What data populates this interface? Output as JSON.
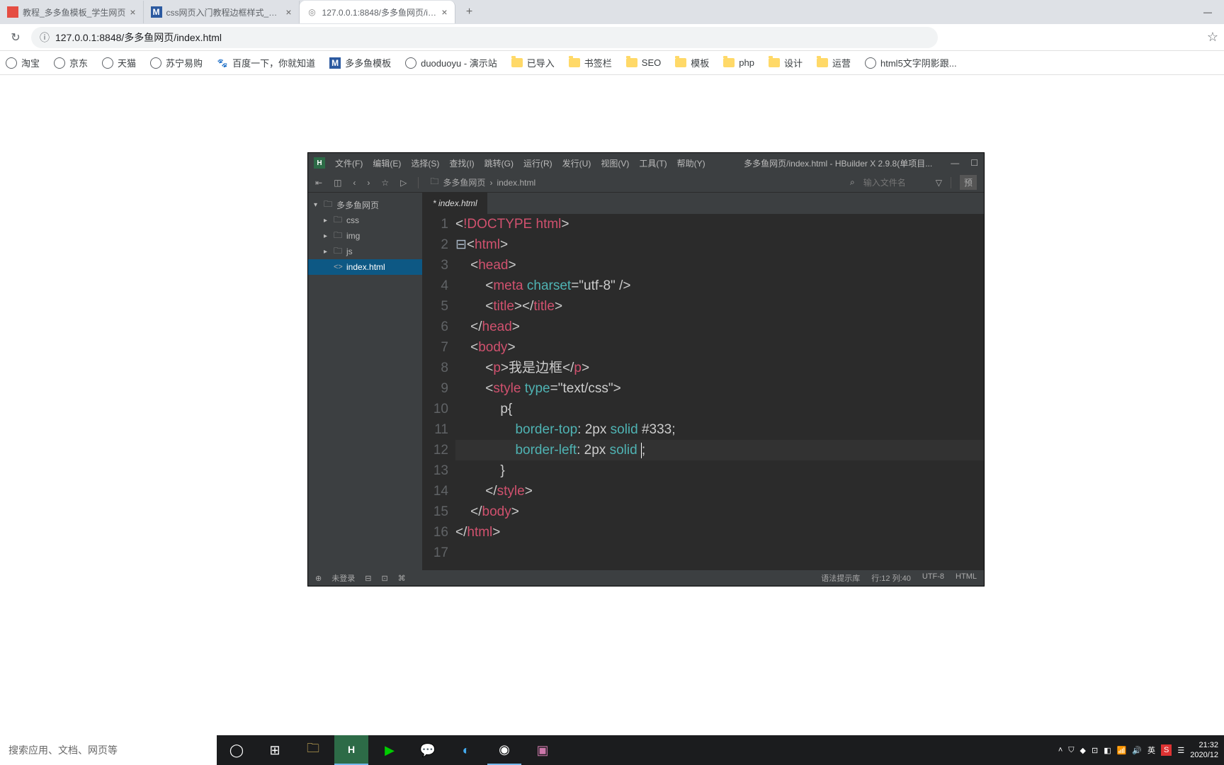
{
  "browser": {
    "tabs": [
      {
        "title": "教程_多多鱼模板_学生网页",
        "favicon_bg": "#e54d42",
        "favicon_text": ""
      },
      {
        "title": "css网页入门教程边框样式_多多...",
        "favicon_bg": "#2c5aa0",
        "favicon_text": "M"
      },
      {
        "title": "127.0.0.1:8848/多多鱼网页/ind...",
        "favicon_bg": "#999",
        "favicon_text": "◎"
      }
    ],
    "url": "127.0.0.1:8848/多多鱼网页/index.html",
    "bookmarks": [
      {
        "label": "淘宝",
        "type": "globe"
      },
      {
        "label": "京东",
        "type": "globe"
      },
      {
        "label": "天猫",
        "type": "globe"
      },
      {
        "label": "苏宁易购",
        "type": "globe"
      },
      {
        "label": "百度一下，你就知道",
        "type": "paw"
      },
      {
        "label": "多多鱼模板",
        "type": "m"
      },
      {
        "label": "duoduoyu - 演示站",
        "type": "globe"
      },
      {
        "label": "已导入",
        "type": "folder"
      },
      {
        "label": "书签栏",
        "type": "folder"
      },
      {
        "label": "SEO",
        "type": "folder"
      },
      {
        "label": "模板",
        "type": "folder"
      },
      {
        "label": "php",
        "type": "folder"
      },
      {
        "label": "设计",
        "type": "folder"
      },
      {
        "label": "运营",
        "type": "folder"
      },
      {
        "label": "html5文字阴影跟...",
        "type": "globe"
      }
    ]
  },
  "editor": {
    "menus": [
      "文件(F)",
      "编辑(E)",
      "选择(S)",
      "查找(I)",
      "跳转(G)",
      "运行(R)",
      "发行(U)",
      "视图(V)",
      "工具(T)",
      "帮助(Y)"
    ],
    "title": "多多鱼网页/index.html - HBuilder X 2.9.8(单项目...",
    "breadcrumb": [
      "多多鱼网页",
      "index.html"
    ],
    "search_placeholder": "输入文件名",
    "preview_label": "预",
    "project": "多多鱼网页",
    "tree": [
      "css",
      "img",
      "js"
    ],
    "tree_file": "index.html",
    "tab_label": "* index.html",
    "code": {
      "l1_doctype": "!DOCTYPE html",
      "l2_html": "html",
      "l3_head": "head",
      "l4_meta": "meta",
      "l4_attr": "charset",
      "l4_val": "\"utf-8\"",
      "l5_title": "title",
      "l6_head_close": "head",
      "l7_body": "body",
      "l8_p": "p",
      "l8_text": "我是边框",
      "l9_style": "style",
      "l9_attr": "type",
      "l9_val": "\"text/css\"",
      "l10": "p{",
      "l11_prop": "border-top",
      "l11_val1": "2px",
      "l11_val2": "solid",
      "l11_val3": "#333",
      "l12_prop": "border-left",
      "l12_val1": "2px",
      "l12_val2": "solid",
      "l13": "}",
      "l14_style_close": "style",
      "l15_body_close": "body",
      "l16_html_close": "html"
    },
    "status": {
      "login": "未登录",
      "syntax": "语法提示库",
      "pos": "行:12 列:40",
      "encoding": "UTF-8",
      "lang": "HTML"
    }
  },
  "taskbar": {
    "search_placeholder": "搜索应用、文档、网页等",
    "time": "21:32",
    "date": "2020/12",
    "ime": "英"
  }
}
